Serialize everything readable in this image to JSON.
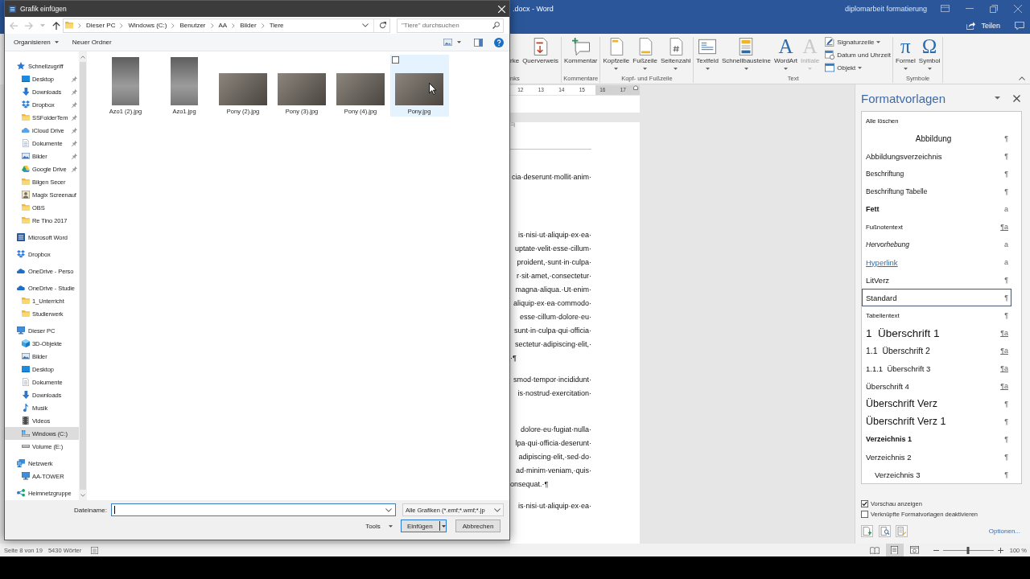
{
  "dialog": {
    "title": "Grafik einfügen",
    "nav_buttons": [
      {
        "kind": "back",
        "disabled": true
      },
      {
        "kind": "forward",
        "disabled": true
      },
      {
        "kind": "recent",
        "disabled": true
      },
      {
        "kind": "up",
        "disabled": false
      }
    ],
    "breadcrumb": [
      "Dieser PC",
      "Windows (C:)",
      "Benutzer",
      "AA",
      "Bilder",
      "Tiere"
    ],
    "search": {
      "placeholder": "\"Tiere\" durchsuchen"
    },
    "toolbar": [
      {
        "label": "Organisieren",
        "dropdown": true
      },
      {
        "label": "Neuer Ordner",
        "dropdown": false
      }
    ],
    "nav": [
      {
        "label": "Schnellzugriff",
        "kind": "star",
        "selected": false,
        "pinned": false,
        "children": [
          {
            "label": "Desktop",
            "kind": "desktop",
            "selected": false,
            "pinned": true
          },
          {
            "label": "Downloads",
            "kind": "download",
            "selected": false,
            "pinned": true
          },
          {
            "label": "Dropbox",
            "kind": "dropbox",
            "selected": false,
            "pinned": true
          },
          {
            "label": "SSFolderTem",
            "kind": "folder",
            "selected": false,
            "pinned": true
          },
          {
            "label": "iCloud Drive",
            "kind": "cloud",
            "selected": false,
            "pinned": true
          },
          {
            "label": "Dokumente",
            "kind": "documents",
            "selected": false,
            "pinned": true
          },
          {
            "label": "Bilder",
            "kind": "pictures",
            "selected": false,
            "pinned": true
          },
          {
            "label": "Google Drive",
            "kind": "gdrive",
            "selected": false,
            "pinned": true
          },
          {
            "label": "Bilgen Secer",
            "kind": "folder",
            "selected": false,
            "pinned": false
          },
          {
            "label": "Magix Screenauf",
            "kind": "contact",
            "selected": false,
            "pinned": false
          },
          {
            "label": "OBS",
            "kind": "folder",
            "selected": false,
            "pinned": false
          },
          {
            "label": "Re Tino 2017",
            "kind": "folder",
            "selected": false,
            "pinned": false
          }
        ]
      },
      {
        "label": "Microsoft Word",
        "kind": "word",
        "selected": false,
        "pinned": false
      },
      {
        "label": "Dropbox",
        "kind": "dropbox",
        "selected": false,
        "pinned": false
      },
      {
        "label": "OneDrive - Perso",
        "kind": "onedrive",
        "selected": false,
        "pinned": false
      },
      {
        "label": "OneDrive - Studie",
        "kind": "onedrive",
        "selected": false,
        "pinned": false,
        "children": [
          {
            "label": "1_Unterricht",
            "kind": "folder",
            "selected": false,
            "pinned": false
          },
          {
            "label": "Studierwerk",
            "kind": "folder",
            "selected": false,
            "pinned": false
          }
        ]
      },
      {
        "label": "Dieser PC",
        "kind": "pc",
        "selected": false,
        "pinned": false,
        "children": [
          {
            "label": "3D-Objekte",
            "kind": "cube",
            "selected": false,
            "pinned": false
          },
          {
            "label": "Bilder",
            "kind": "pictures",
            "selected": false,
            "pinned": false
          },
          {
            "label": "Desktop",
            "kind": "desktop",
            "selected": false,
            "pinned": false
          },
          {
            "label": "Dokumente",
            "kind": "documents",
            "selected": false,
            "pinned": false
          },
          {
            "label": "Downloads",
            "kind": "download",
            "selected": false,
            "pinned": false
          },
          {
            "label": "Musik",
            "kind": "music",
            "selected": false,
            "pinned": false
          },
          {
            "label": "Videos",
            "kind": "video",
            "selected": false,
            "pinned": false
          },
          {
            "label": "Windows (C:)",
            "kind": "sysdrive",
            "selected": true,
            "pinned": false
          },
          {
            "label": "Volume (E:)",
            "kind": "drive",
            "selected": false,
            "pinned": false
          }
        ]
      },
      {
        "label": "Netzwerk",
        "kind": "network",
        "selected": false,
        "pinned": false,
        "children": [
          {
            "label": "AA-TOWER",
            "kind": "pc",
            "selected": false,
            "pinned": false
          }
        ]
      },
      {
        "label": "Heimnetzgruppe",
        "kind": "homegroup",
        "selected": false,
        "pinned": false
      }
    ],
    "files": [
      {
        "name": "Azo1 (2).jpg",
        "kind": "portrait",
        "hovered": false,
        "checked": false
      },
      {
        "name": "Azo1.jpg",
        "kind": "portrait",
        "hovered": false,
        "checked": false
      },
      {
        "name": "Pony (2).jpg",
        "kind": "landscape",
        "hovered": false,
        "checked": false
      },
      {
        "name": "Pony (3).jpg",
        "kind": "landscape",
        "hovered": false,
        "checked": false
      },
      {
        "name": "Pony (4).jpg",
        "kind": "landscape",
        "hovered": false,
        "checked": false
      },
      {
        "name": "Pony.jpg",
        "kind": "landscape",
        "hovered": true,
        "checked": false
      }
    ],
    "filename": {
      "label": "Dateiname:",
      "focused": true
    },
    "filter": "Alle Grafiken (*.emf;*.wmf;*.jp",
    "buttons": [
      {
        "label": "Tools",
        "kind": "menu"
      },
      {
        "label": "Einfügen",
        "kind": "split"
      },
      {
        "label": "Abbrechen",
        "kind": "cancel"
      }
    ]
  },
  "word": {
    "title": ".docx - Word",
    "user": "diplomarbeit formatierung",
    "share": "Teilen",
    "ribbon": {
      "groups": [
        {
          "label": "nks",
          "buttons": [
            {
              "label": "rke",
              "kind": "bare",
              "dropdown": false,
              "disabled": false
            },
            {
              "label": "Querverweis",
              "kind": "crossref",
              "dropdown": false,
              "disabled": false
            }
          ]
        },
        {
          "label": "Kommentare",
          "buttons": [
            {
              "label": "Kommentar",
              "kind": "comment",
              "dropdown": false,
              "disabled": false
            }
          ]
        },
        {
          "label": "Kopf- und Fußzeile",
          "buttons": [
            {
              "label": "Kopfzeile",
              "kind": "header",
              "dropdown": true,
              "disabled": false
            },
            {
              "label": "Fußzeile",
              "kind": "footer",
              "dropdown": true,
              "disabled": false
            },
            {
              "label": "Seitenzahl",
              "kind": "pagenumber",
              "dropdown": true,
              "disabled": false
            }
          ]
        },
        {
          "label": "Text",
          "buttons": [
            {
              "label": "Textfeld",
              "kind": "textbox",
              "dropdown": true,
              "disabled": false
            },
            {
              "label": "Schnellbausteine",
              "kind": "quickparts",
              "dropdown": true,
              "disabled": false
            },
            {
              "label": "WordArt",
              "kind": "glyph",
              "glyph": "A",
              "dropdown": true,
              "disabled": false
            },
            {
              "label": "Initiale",
              "kind": "glyph",
              "glyph": "A",
              "dropdown": true,
              "disabled": true
            }
          ],
          "small_buttons": [
            {
              "label": "Signaturzeile",
              "kind": "signature",
              "dropdown": true
            },
            {
              "label": "Datum und Uhrzeit",
              "kind": "datetime",
              "dropdown": false
            },
            {
              "label": "Objekt",
              "kind": "object",
              "dropdown": true
            }
          ]
        },
        {
          "label": "Symbole",
          "buttons": [
            {
              "label": "Formel",
              "kind": "glyph",
              "glyph": "π",
              "dropdown": true,
              "disabled": false
            },
            {
              "label": "Symbol",
              "kind": "glyph",
              "glyph": "Ω",
              "dropdown": true,
              "disabled": false
            }
          ]
        }
      ]
    },
    "ruler": [
      "12",
      "13",
      "14",
      "15",
      "16",
      "17"
    ],
    "document": {
      "paragraphs": [
        {
          "lines": [
            {
              "text": "cia·deserunt·mollit·anim·",
              "kind": "justified"
            }
          ]
        },
        {
          "lines": [
            {
              "text": "is·nisi·ut·aliquip·ex·ea·",
              "kind": "justified"
            },
            {
              "text": "uptate·velit·esse·cillum·",
              "kind": "justified"
            },
            {
              "text": "proident,·sunt·in·culpa·",
              "kind": "justified"
            },
            {
              "text": "r·sit·amet,·consectetur·",
              "kind": "justified"
            },
            {
              "text": "magna·aliqua.·Ut·enim·",
              "kind": "justified"
            },
            {
              "text": "aliquip·ex·ea·commodo·",
              "kind": "justified"
            },
            {
              "text": "esse·cillum·dolore·eu·",
              "kind": "justified"
            },
            {
              "text": "sunt·in·culpa·qui·officia·",
              "kind": "justified"
            },
            {
              "text": "sectetur·adipiscing·elit,·",
              "kind": "justified"
            },
            {
              "text": "·¶",
              "kind": "last"
            }
          ]
        },
        {
          "lines": [
            {
              "text": "smod·tempor·incididunt·",
              "kind": "justified"
            },
            {
              "text": "is·nostrud·exercitation·",
              "kind": "justified"
            }
          ]
        },
        {
          "lines": [
            {
              "text": "dolore·eu·fugiat·nulla·",
              "kind": "justified"
            },
            {
              "text": "lpa·qui·officia·deserunt·",
              "kind": "justified"
            },
            {
              "text": "adipiscing·elit,·sed·do·",
              "kind": "justified"
            },
            {
              "text": "ad·minim·veniam,·quis·",
              "kind": "justified"
            },
            {
              "text": "onsequat.·¶",
              "kind": "last"
            }
          ]
        },
        {
          "lines": [
            {
              "text": "is·nisi·ut·aliquip·ex·ea·",
              "kind": "justified"
            }
          ]
        }
      ]
    },
    "styles_pane": {
      "title": "Formatvorlagen",
      "clear_all": "Alle löschen",
      "styles": [
        {
          "label": "Abbildung",
          "kind": "centered",
          "marker": "¶",
          "linked": false,
          "selected": false
        },
        {
          "label": "Abbildungsverzeichnis",
          "kind": "normal",
          "marker": "¶",
          "linked": false,
          "selected": false
        },
        {
          "label": "Beschriftung",
          "kind": "small",
          "marker": "¶",
          "linked": false,
          "selected": false
        },
        {
          "label": "Beschriftung Tabelle",
          "kind": "small",
          "marker": "¶",
          "linked": false,
          "selected": false
        },
        {
          "label": "Fett",
          "kind": "bold",
          "marker": "a",
          "linked": false,
          "selected": false
        },
        {
          "label": "Fußnotentext",
          "kind": "tiny",
          "marker": "¶a",
          "linked": true,
          "selected": false
        },
        {
          "label": "Hervorhebung",
          "kind": "italic",
          "marker": "a",
          "linked": false,
          "selected": false
        },
        {
          "label": "Hyperlink",
          "kind": "link",
          "marker": "a",
          "linked": false,
          "selected": false
        },
        {
          "label": "LitVerz",
          "kind": "normal",
          "marker": "¶",
          "linked": false,
          "selected": false
        },
        {
          "label": "Standard",
          "kind": "normal",
          "marker": "¶",
          "linked": false,
          "selected": true
        },
        {
          "label": "Tabellentext",
          "kind": "tiny",
          "marker": "¶",
          "linked": false,
          "selected": false
        },
        {
          "label": "1  Überschrift 1",
          "kind": "heading1",
          "marker": "¶a",
          "linked": true,
          "selected": false
        },
        {
          "label": "1.1  Überschrift 2",
          "kind": "heading2",
          "marker": "¶a",
          "linked": true,
          "selected": false
        },
        {
          "label": "1.1.1  Überschrift 3",
          "kind": "normal",
          "marker": "¶a",
          "linked": true,
          "selected": false
        },
        {
          "label": "Überschrift 4",
          "kind": "normal",
          "marker": "¶a",
          "linked": true,
          "selected": false
        },
        {
          "label": "Überschrift Verz",
          "kind": "title",
          "marker": "¶",
          "linked": false,
          "selected": false
        },
        {
          "label": "Überschrift Verz 1",
          "kind": "title",
          "marker": "¶",
          "linked": false,
          "selected": false
        },
        {
          "label": "Verzeichnis 1",
          "kind": "bold",
          "marker": "¶",
          "linked": false,
          "selected": false
        },
        {
          "label": "Verzeichnis 2",
          "kind": "normal",
          "marker": "¶",
          "linked": false,
          "selected": false
        },
        {
          "label": "Verzeichnis 3",
          "kind": "indented",
          "marker": "¶",
          "linked": false,
          "selected": false
        }
      ],
      "options": [
        {
          "label": "Vorschau anzeigen",
          "checked": true
        },
        {
          "label": "Verknüpfte Formatvorlagen deaktivieren",
          "checked": false
        }
      ],
      "options_link": "Optionen..."
    },
    "status_bar": {
      "page": "Seite 8 von 19",
      "words": "5430 Wörter",
      "views": [
        {
          "kind": "read",
          "selected": false
        },
        {
          "kind": "print",
          "selected": true
        },
        {
          "kind": "web",
          "selected": false
        }
      ],
      "zoom": {
        "level": 0.5,
        "label": "100 %"
      }
    }
  }
}
